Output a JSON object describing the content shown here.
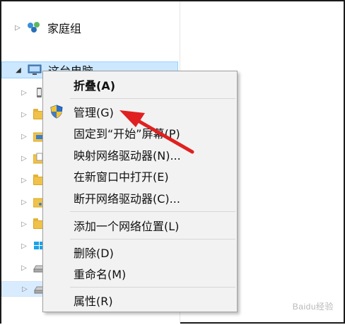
{
  "nav": {
    "homegroup_label": "家庭组",
    "thispc_label": "这台电脑"
  },
  "menu": {
    "items": [
      {
        "label": "折叠(A)"
      },
      {
        "label": "管理(G)"
      },
      {
        "label": "固定到“开始”屏幕(P)"
      },
      {
        "label": "映射网络驱动器(N)..."
      },
      {
        "label": "在新窗口中打开(E)"
      },
      {
        "label": "断开网络驱动器(C)..."
      },
      {
        "label": "添加一个网络位置(L)"
      },
      {
        "label": "删除(D)"
      },
      {
        "label": "重命名(M)"
      },
      {
        "label": "属性(R)"
      }
    ]
  },
  "watermark": "Baidu经验",
  "colors": {
    "selection": "#cce8ff",
    "arrow": "#e02020",
    "menu_bg": "#f2f2f2"
  }
}
